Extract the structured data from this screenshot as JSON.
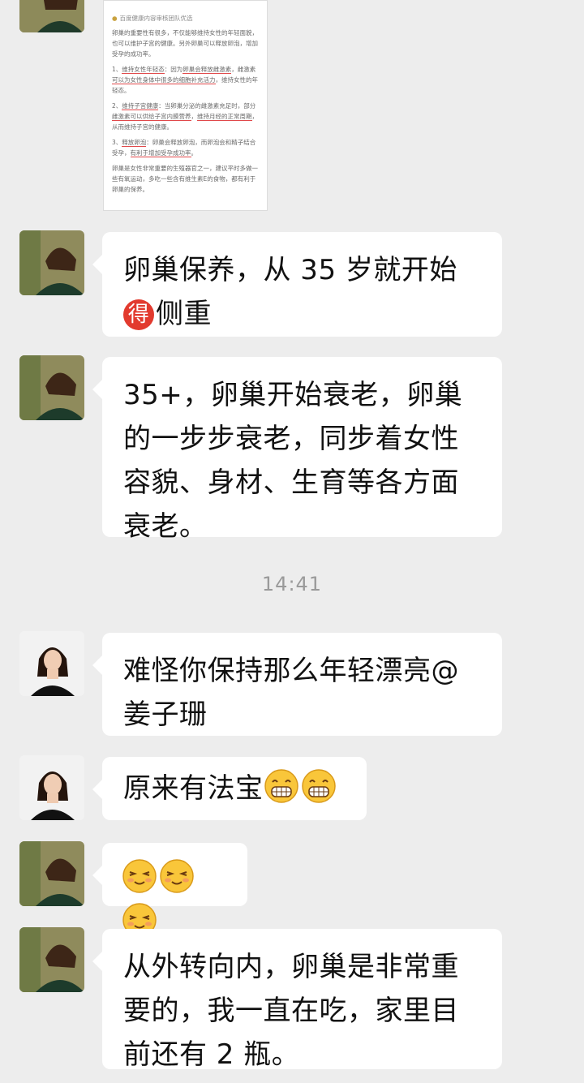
{
  "article": {
    "source": "百度健康内容审核团队优选",
    "p1": "卵巢的重要性有很多，不仅能够维持女性的年轻面貌，也可以维护子宫的健康。另外卵巢可以释放卵泡，增加受孕的成功率。",
    "p2_num": "1、",
    "p2_key": "维持女性年轻态",
    "p2_a": "：因为",
    "p2_u1": "卵巢会释放雌激素",
    "p2_b": "，雌激素",
    "p2_u2": "可以为女性身体中很多的细胞补充活力",
    "p2_c": "，维持女性的年轻态。",
    "p3_num": "2、",
    "p3_key": "维持子宫健康",
    "p3_a": "：当卵巢分泌的雌激素充足时，部分",
    "p3_u1": "雌激素可以供给子宫内膜营养",
    "p3_b": "，",
    "p3_u2": "维持月经的正常周期",
    "p3_c": "，从而维持子宫的健康。",
    "p4_num": "3、",
    "p4_key": "释放卵泡",
    "p4_a": "：卵巢会释放卵泡，而卵泡会和精子结合受孕，",
    "p4_u1": "有利于增加受孕成功率",
    "p4_b": "。",
    "p5": "卵巢是女性非常重要的生殖器官之一，建议平时多做一些有氧运动，多吃一些含有维生素E的食物，都有利于卵巢的保养。"
  },
  "messages": {
    "m1_line1": "卵巢保养，从 35 岁就开始",
    "m1_badge": "得",
    "m1_tail": "侧重",
    "m2_text": "35+，卵巢开始衰老，卵巢的一步步衰老，同步着女性容貌、身材、生育等各方面衰老。",
    "timestamp": "14:41",
    "m3_text": "难怪你保持那么年轻漂亮@姜子珊",
    "m4_text": "原来有法宝",
    "m6_text": "从外转向内，卵巢是非常重要的，我一直在吃，家里目前还有 2 瓶。"
  },
  "icons": {
    "grin": "grin-emoji-icon",
    "shy": "shy-smile-emoji-icon"
  },
  "colors": {
    "background": "#ededed",
    "bubble": "#ffffff",
    "badge_red": "#e23a2e",
    "underline_red": "#e0484a"
  }
}
